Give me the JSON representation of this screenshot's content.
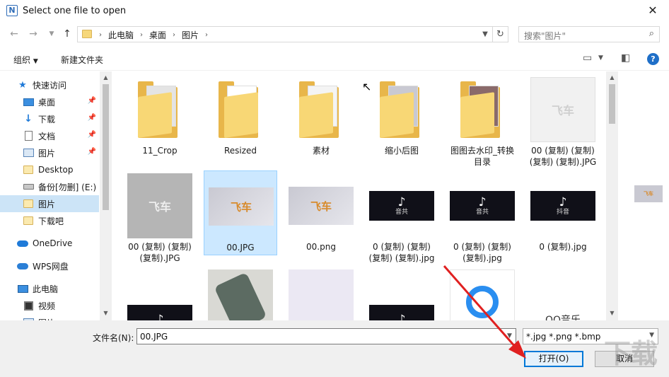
{
  "window": {
    "title": "Select one file to open",
    "close_glyph": "✕",
    "app_icon_letter": "N"
  },
  "address": {
    "crumbs": [
      "此电脑",
      "桌面",
      "图片"
    ],
    "search_placeholder": "搜索\"图片\""
  },
  "toolbar": {
    "organize": "组织",
    "new_folder": "新建文件夹",
    "help": "?"
  },
  "sidebar": {
    "quick_access": "快速访问",
    "items": [
      {
        "label": "桌面",
        "icon": "desktop-icon",
        "pinned": true
      },
      {
        "label": "下载",
        "icon": "download-icon",
        "pinned": true
      },
      {
        "label": "文档",
        "icon": "document-icon",
        "pinned": true
      },
      {
        "label": "图片",
        "icon": "pictures-icon",
        "pinned": true
      },
      {
        "label": "Desktop",
        "icon": "folder-icon",
        "pinned": false
      },
      {
        "label": "备份[勿删] (E:)",
        "icon": "drive-icon",
        "pinned": false
      },
      {
        "label": "图片",
        "icon": "folder-icon",
        "pinned": false,
        "selected": true
      },
      {
        "label": "下载吧",
        "icon": "folder-icon",
        "pinned": false
      }
    ],
    "onedrive": "OneDrive",
    "wps": "WPS网盘",
    "this_pc": "此电脑",
    "videos": "视频",
    "pictures_partial": "图片"
  },
  "files": [
    {
      "name": "11_Crop",
      "kind": "folder"
    },
    {
      "name": "Resized",
      "kind": "folder"
    },
    {
      "name": "素材",
      "kind": "folder"
    },
    {
      "name": "缩小后图",
      "kind": "folder"
    },
    {
      "name": "图图去水印_转换目录",
      "kind": "folder"
    },
    {
      "name": "00 (复制) (复制) (复制) (复制).JPG",
      "kind": "white-logo"
    },
    {
      "name": "00 (复制) (复制) (复制).JPG",
      "kind": "gray-logo"
    },
    {
      "name": "00.JPG",
      "kind": "logo",
      "selected": true
    },
    {
      "name": "00.png",
      "kind": "logo"
    },
    {
      "name": "0 (复制) (复制) (复制) (复制).jpg",
      "kind": "tiktok"
    },
    {
      "name": "0 (复制) (复制) (复制).jpg",
      "kind": "tiktok"
    },
    {
      "name": "0 (复制).jpg",
      "kind": "tiktok"
    },
    {
      "name": "",
      "kind": "tiktok"
    },
    {
      "name": "",
      "kind": "phone"
    },
    {
      "name": "",
      "kind": "phones"
    },
    {
      "name": "",
      "kind": "tiktok"
    },
    {
      "name": "",
      "kind": "qq"
    },
    {
      "name": "",
      "kind": "qq-music"
    }
  ],
  "thumb_text": {
    "logo": "飞车",
    "tiktok_note": "♪",
    "tiktok_sub_a": "音共",
    "tiktok_sub_b": "抖音",
    "qq_music": "QQ音乐"
  },
  "bottom": {
    "filename_label": "文件名(N):",
    "filename_value": "00.JPG",
    "filter_value": "*.jpg *.png *.bmp",
    "open_button": "打开(O)",
    "cancel_button": "取消"
  },
  "watermark": "下载",
  "colors": {
    "accent": "#0078d7",
    "selection": "#cce8ff",
    "annotation_arrow": "#e02020"
  }
}
